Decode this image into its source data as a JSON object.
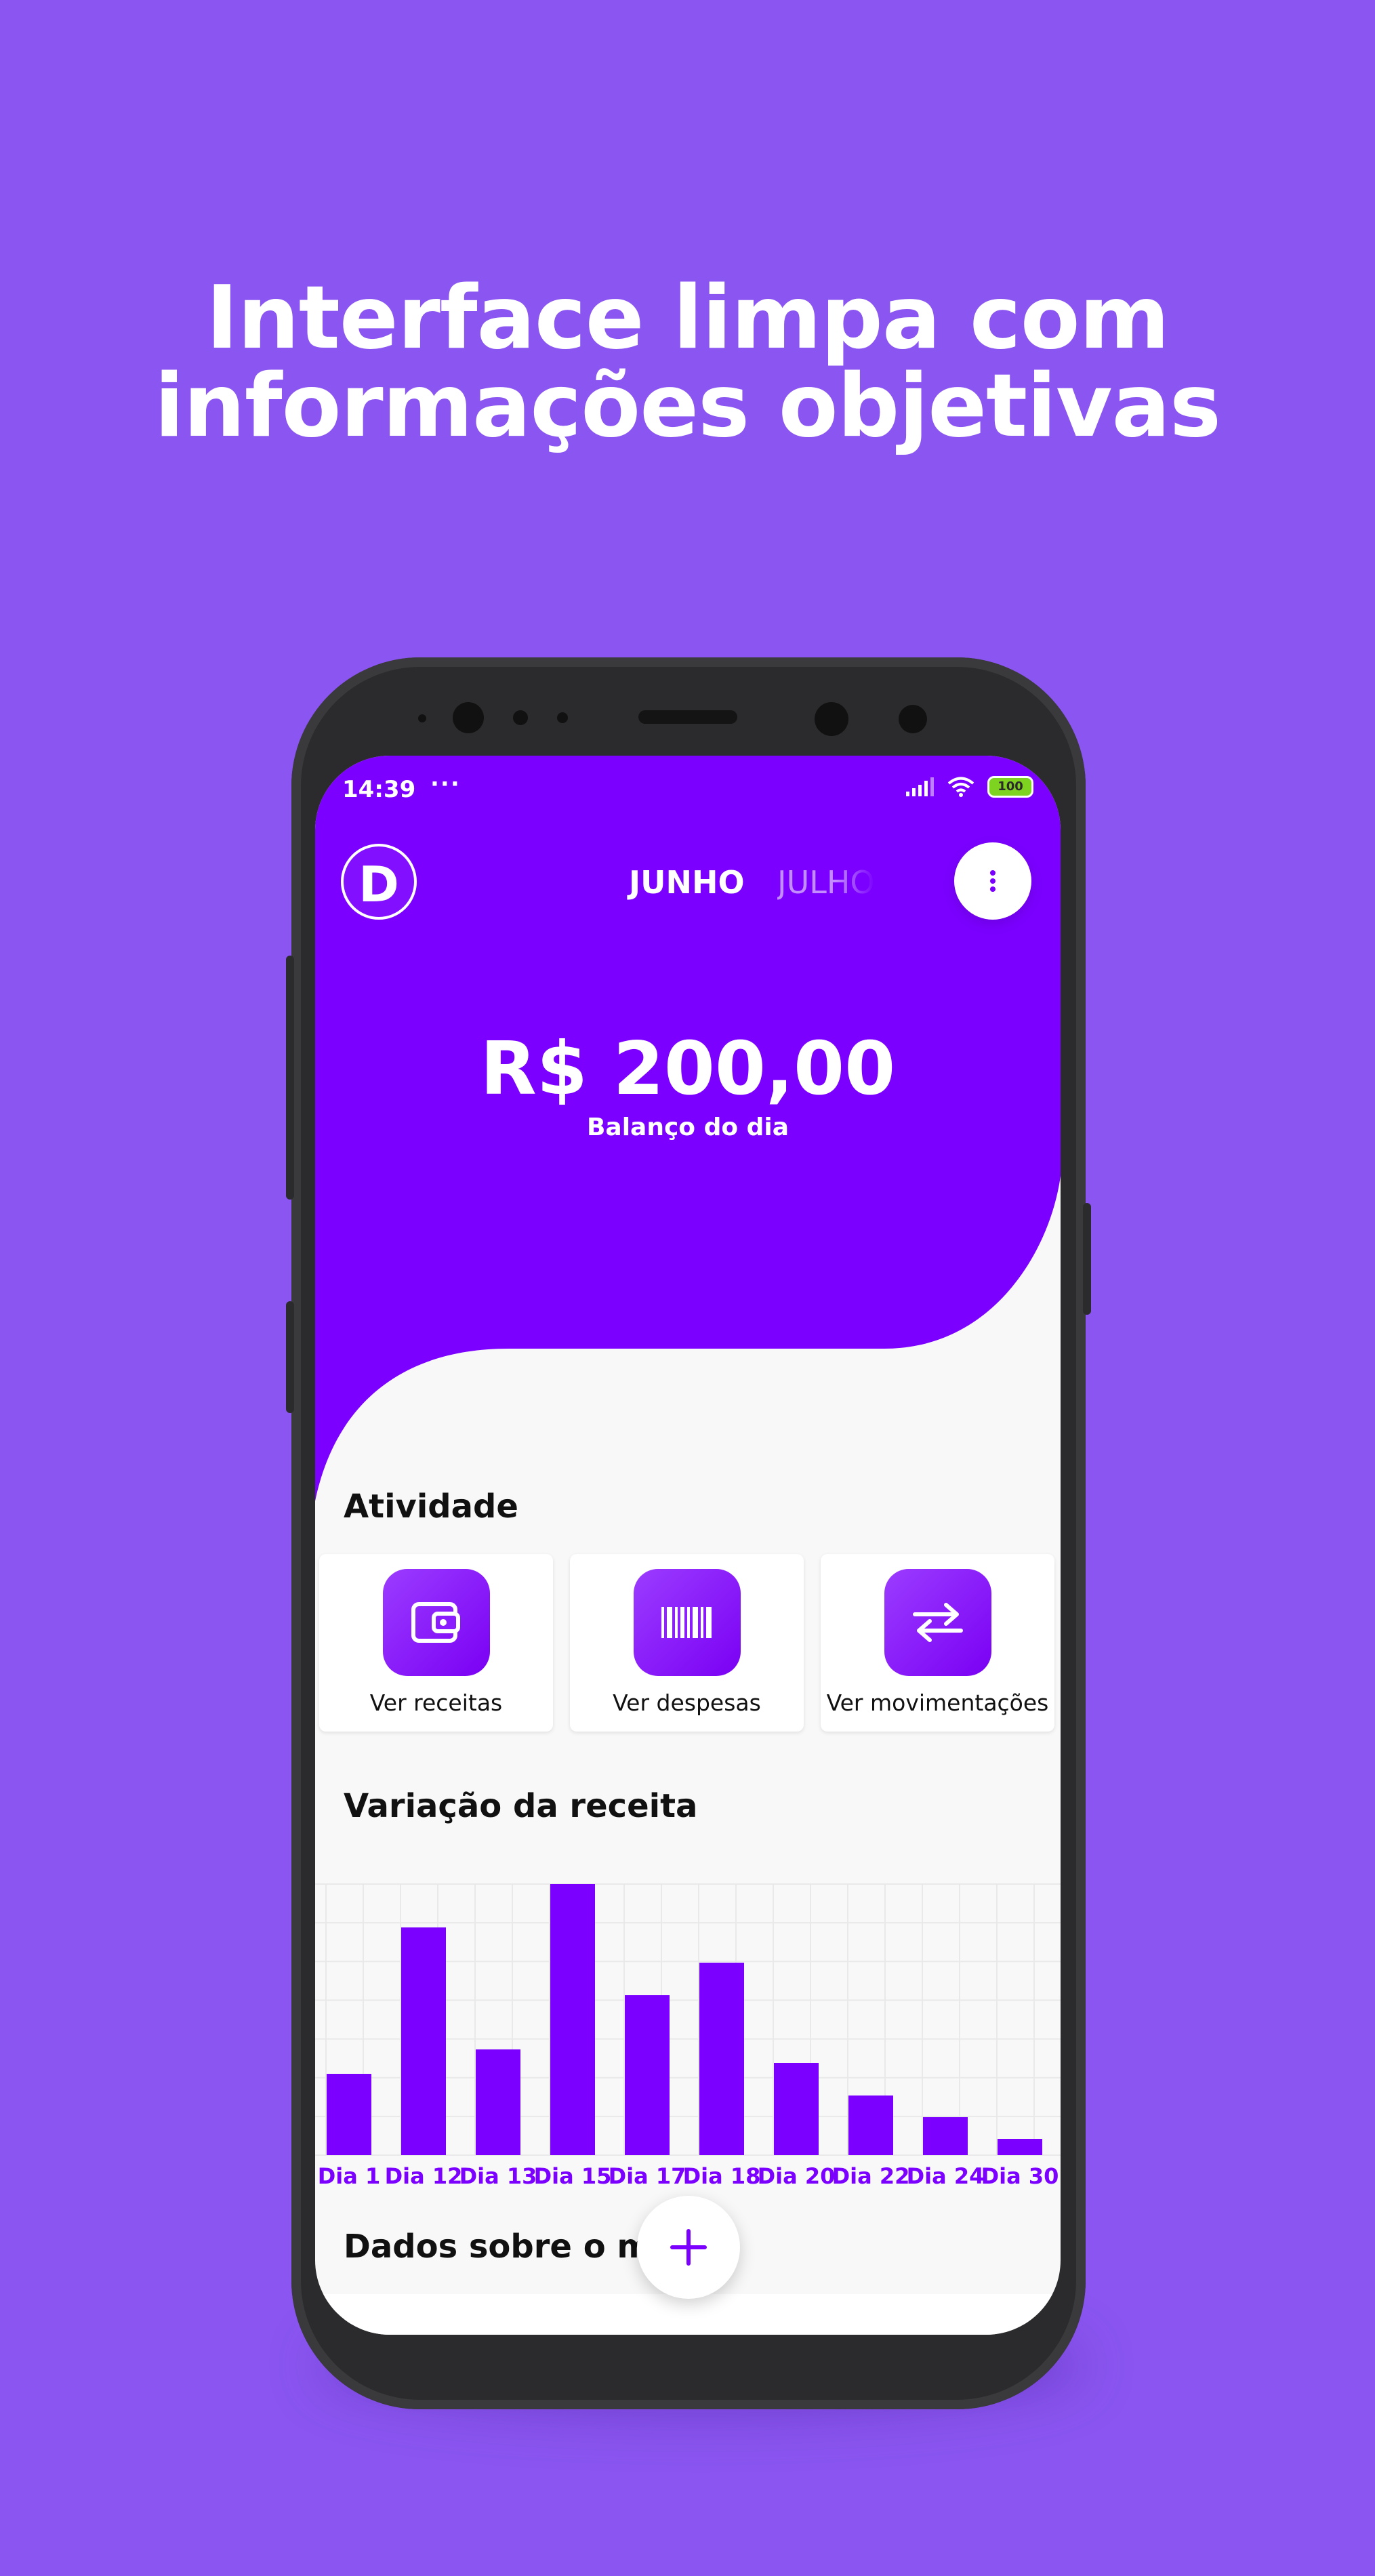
{
  "headline": {
    "line1": "Interface limpa com",
    "line2": "informações objetivas"
  },
  "status_bar": {
    "time": "14:39",
    "more": "···",
    "battery": "100"
  },
  "header": {
    "avatar_letter": "D",
    "months": [
      "JUNHO",
      "JULHO"
    ],
    "balance": "R$ 200,00",
    "balance_label": "Balanço do dia"
  },
  "activity": {
    "title": "Atividade",
    "items": [
      {
        "label": "Ver receitas",
        "icon": "wallet-icon"
      },
      {
        "label": "Ver despesas",
        "icon": "barcode-icon"
      },
      {
        "label": "Ver movimentações",
        "icon": "transfer-arrows-icon"
      }
    ]
  },
  "revenue": {
    "title": "Variação da receita"
  },
  "chart_data": {
    "type": "bar",
    "categories": [
      "Dia 1",
      "Dia 12",
      "Dia 13",
      "Dia 15",
      "Dia 17",
      "Dia 18",
      "Dia 20",
      "Dia 22",
      "Dia 24",
      "Dia 30"
    ],
    "values": [
      30,
      84,
      39,
      100,
      59,
      71,
      34,
      22,
      14,
      6
    ],
    "title": "Variação da receita",
    "xlabel": "",
    "ylabel": "",
    "ylim": [
      0,
      100
    ],
    "grid": true,
    "bar_color": "#7b00ff",
    "label_color": "#7b00ff"
  },
  "month_data": {
    "title": "Dados sobre o mês"
  },
  "fab": {
    "label": "+"
  },
  "colors": {
    "background": "#8a55f0",
    "primary": "#7b00ff",
    "surface": "#f8f8f8"
  }
}
